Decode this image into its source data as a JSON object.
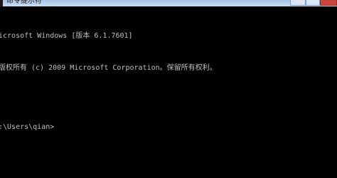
{
  "window": {
    "title": "命令提示符",
    "icon": "cmd-icon",
    "colors": {
      "background": "#000000",
      "text": "#c0c0c0",
      "titlebar": "#b9d1ea"
    }
  },
  "console": {
    "lines": [
      "icrosoft Windows [版本 6.1.7601]",
      "版权所有 (c) 2009 Microsoft Corporation。保留所有权利。",
      ":\\Users\\qian>"
    ]
  }
}
